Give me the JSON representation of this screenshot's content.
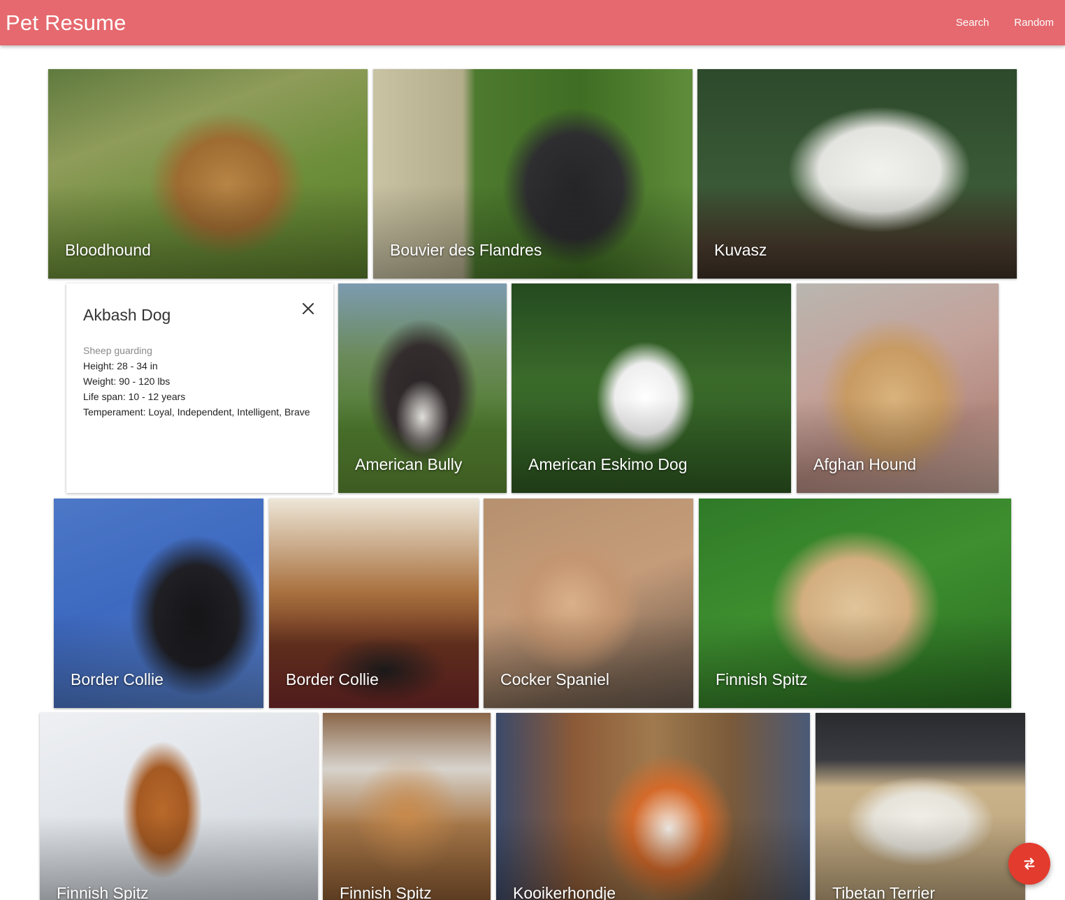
{
  "appbar": {
    "title": "Pet Resume",
    "search_label": "Search",
    "random_label": "Random"
  },
  "colors": {
    "appbar": "#e5696e",
    "fab": "#e33b2e"
  },
  "tiles": [
    {
      "name": "Bloodhound"
    },
    {
      "name": "Bouvier des Flandres"
    },
    {
      "name": "Kuvasz"
    },
    {
      "name": "American Bully"
    },
    {
      "name": "American Eskimo Dog"
    },
    {
      "name": "Afghan Hound"
    },
    {
      "name": "Border Collie"
    },
    {
      "name": "Border Collie"
    },
    {
      "name": "Cocker Spaniel"
    },
    {
      "name": "Finnish Spitz"
    },
    {
      "name": "Finnish Spitz"
    },
    {
      "name": "Finnish Spitz"
    },
    {
      "name": "Kooikerhondje"
    },
    {
      "name": "Tibetan Terrier"
    }
  ],
  "detail": {
    "title": "Akbash Dog",
    "group": "Sheep guarding",
    "height": "Height: 28 - 34 in",
    "weight": "Weight: 90 - 120 lbs",
    "life_span": "Life span: 10 - 12 years",
    "temperament": "Temperament: Loyal, Independent, Intelligent, Brave"
  },
  "fab": {
    "icon": "swap-icon"
  }
}
